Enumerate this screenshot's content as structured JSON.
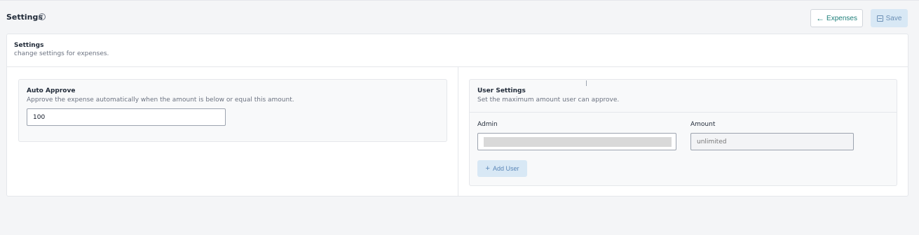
{
  "header": {
    "title": "Settings",
    "help_icon": "help-circle-icon",
    "back_button_label": "Expenses",
    "back_icon": "arrow-left-icon",
    "save_button_label": "Save",
    "save_icon": "floppy-disk-icon"
  },
  "card": {
    "title": "Settings",
    "subtitle": "change settings for expenses."
  },
  "auto_approve": {
    "title": "Auto Approve",
    "description": "Approve the expense automatically when the amount is below or equal this amount.",
    "value": "100"
  },
  "user_settings": {
    "title": "User Settings",
    "description": "Set the maximum amount user can approve.",
    "admin_label": "Admin",
    "amount_label": "Amount",
    "amount_placeholder": "unlimited",
    "add_user_label": "Add User",
    "add_icon": "plus-icon"
  },
  "colors": {
    "accent": "#1e7f7a",
    "save_bg": "#d8e8f5",
    "page_bg": "#f4f5f7"
  }
}
